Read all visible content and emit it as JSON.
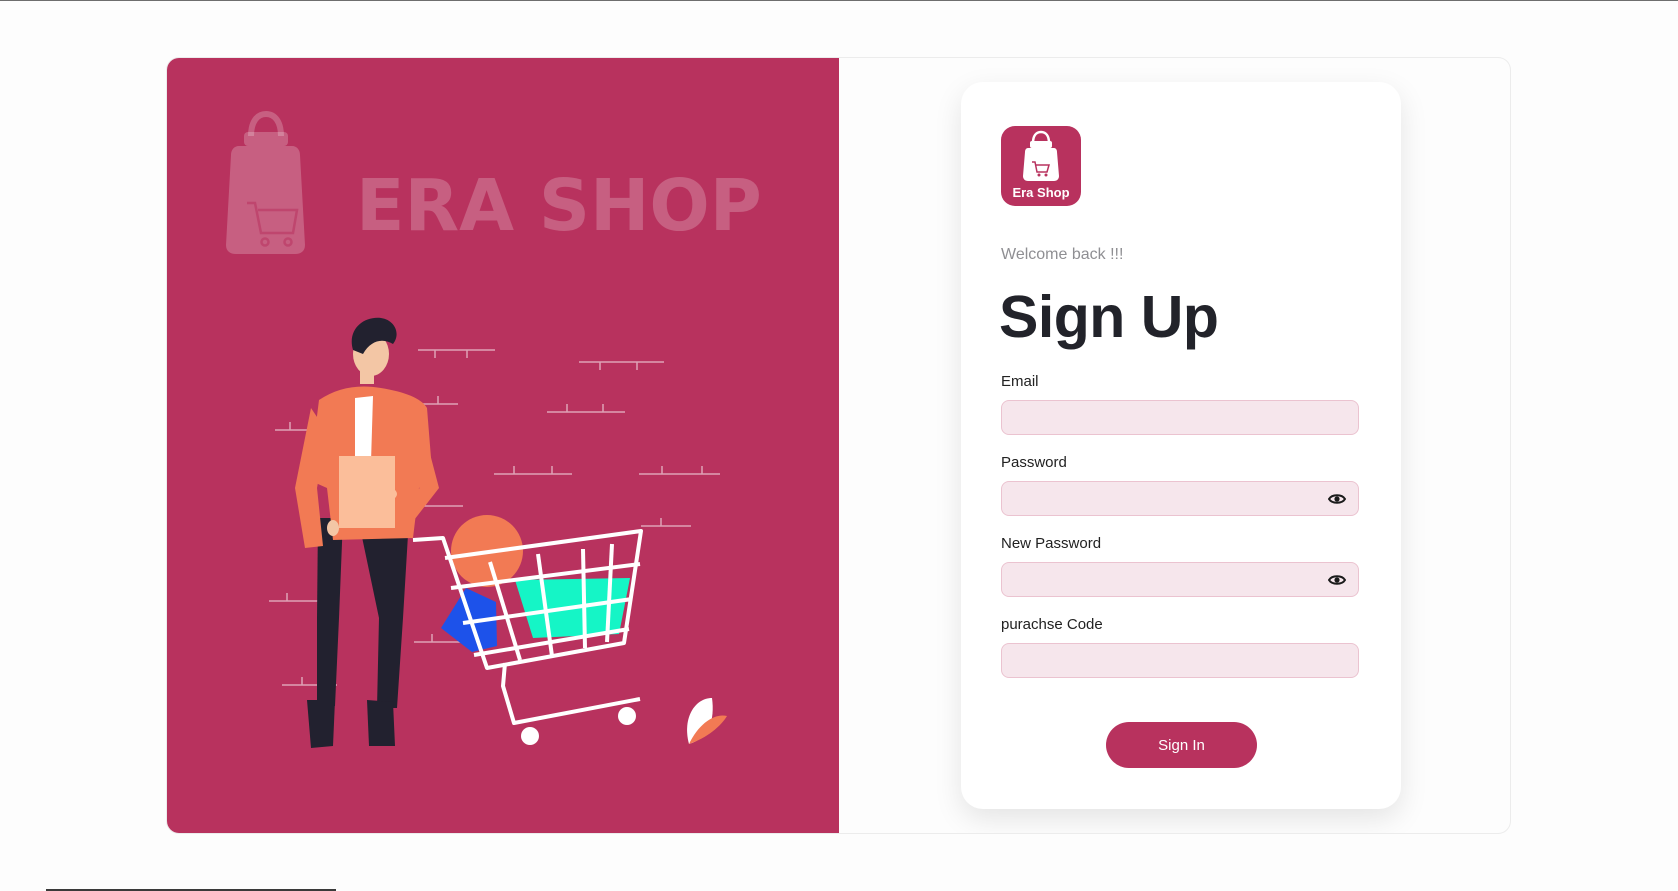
{
  "brand": {
    "watermark_text": "ERA SHOP",
    "logo_text": "Era Shop"
  },
  "form": {
    "welcome": "Welcome back !!!",
    "title": "Sign Up",
    "fields": [
      {
        "label": "Email",
        "value": "",
        "type": "email",
        "has_eye": false
      },
      {
        "label": "Password",
        "value": "",
        "type": "password",
        "has_eye": true
      },
      {
        "label": "New Password",
        "value": "",
        "type": "password",
        "has_eye": true
      },
      {
        "label": "purachse Code",
        "value": "",
        "type": "text",
        "has_eye": false
      }
    ],
    "submit_label": "Sign In"
  },
  "colors": {
    "brand": "#b8325e",
    "field_bg": "#f6e6ec",
    "field_border": "#ebc3d0",
    "title": "#22232a",
    "welcome": "#8f8f93"
  },
  "icons": {
    "bag": "shopping-bag-icon",
    "eye": "eye-icon"
  }
}
